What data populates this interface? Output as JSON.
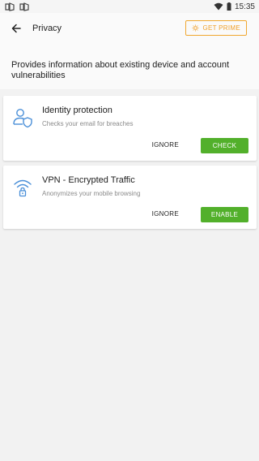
{
  "status_bar": {
    "left_glyphs": [
      "𝄜",
      "𝄜"
    ],
    "time": "15:35",
    "icons": [
      "wifi-icon",
      "battery-icon"
    ]
  },
  "app_bar": {
    "title": "Privacy",
    "back_icon": "arrow-back-icon",
    "prime_label": "GET PRIME",
    "prime_icon": "sun-icon",
    "prime_color": "#f0a02a"
  },
  "intro": {
    "text": "Provides information about existing device and account vulnerabilities"
  },
  "cards": [
    {
      "icon": "identity-shield-icon",
      "title": "Identity protection",
      "subtitle": "Checks your email for breaches",
      "ignore_label": "IGNORE",
      "action_label": "CHECK"
    },
    {
      "icon": "wifi-lock-icon",
      "title": "VPN - Encrypted Traffic",
      "subtitle": "Anonymizes your mobile browsing",
      "ignore_label": "IGNORE",
      "action_label": "ENABLE"
    }
  ],
  "colors": {
    "accent_green": "#52b02b",
    "icon_blue": "#4a8fd8",
    "prime_orange": "#f0a830"
  }
}
